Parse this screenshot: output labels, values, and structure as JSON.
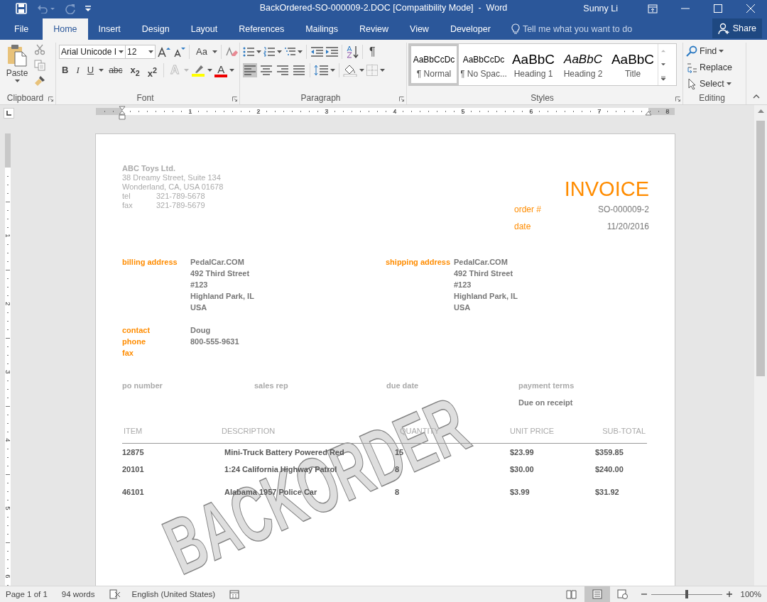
{
  "title_bar": {
    "title": "BackOrdered-SO-000009-2.DOC [Compatibility Mode]  -  Word",
    "user": "Sunny Li"
  },
  "tabs": [
    {
      "label": "File",
      "selected": false
    },
    {
      "label": "Home",
      "selected": true
    },
    {
      "label": "Insert",
      "selected": false
    },
    {
      "label": "Design",
      "selected": false
    },
    {
      "label": "Layout",
      "selected": false
    },
    {
      "label": "References",
      "selected": false
    },
    {
      "label": "Mailings",
      "selected": false
    },
    {
      "label": "Review",
      "selected": false
    },
    {
      "label": "View",
      "selected": false
    },
    {
      "label": "Developer",
      "selected": false
    }
  ],
  "tell_me": {
    "placeholder": "Tell me what you want to do"
  },
  "share": {
    "label": "Share"
  },
  "ribbon": {
    "clipboard": {
      "label": "Clipboard",
      "paste": "Paste"
    },
    "font": {
      "label": "Font",
      "font_name": "Arial Unicode I",
      "font_size": "12",
      "change_case": "Aa",
      "buttons": [
        {
          "kind": "bold",
          "label": "B"
        },
        {
          "kind": "italic",
          "label": "I"
        },
        {
          "kind": "underline",
          "label": "U"
        },
        {
          "kind": "strike",
          "label": "abc"
        },
        {
          "kind": "sub",
          "label": "x$_{2}$"
        },
        {
          "kind": "sup",
          "label": "x$^{2}$"
        }
      ],
      "text_effects": "A",
      "font_color": "A"
    },
    "paragraph": {
      "label": "Paragraph",
      "pilcrow": "¶",
      "alignment": [
        {
          "kind": "left",
          "selected": true
        },
        {
          "kind": "center",
          "selected": false
        },
        {
          "kind": "right",
          "selected": false
        },
        {
          "kind": "justify",
          "selected": false
        }
      ]
    },
    "styles": {
      "label": "Styles",
      "items": [
        {
          "kind": "normal",
          "preview": "AaBbCcDc",
          "name": "¶ Normal",
          "selected": true
        },
        {
          "kind": "normal",
          "preview": "AaBbCcDc",
          "name": "¶ No Spac...",
          "selected": false
        },
        {
          "kind": "heading",
          "preview": "AaBbC",
          "name": "Heading 1",
          "selected": false
        },
        {
          "kind": "heading_italic",
          "preview": "AaBbC",
          "name": "Heading 2",
          "selected": false
        },
        {
          "kind": "title",
          "preview": "AaBbC",
          "name": "Title",
          "selected": false
        }
      ]
    },
    "editing": {
      "label": "Editing",
      "items": [
        {
          "kind": "find",
          "label": "Find"
        },
        {
          "kind": "replace",
          "label": "Replace"
        },
        {
          "kind": "select",
          "label": "Select"
        }
      ]
    }
  },
  "ruler": {
    "labels": [
      "1",
      "2",
      "3",
      "4",
      "5",
      "6",
      "7",
      "8"
    ]
  },
  "vertical_ruler": {
    "labels": [
      "1",
      "2",
      "3",
      "4",
      "5",
      "6"
    ]
  },
  "document": {
    "company": {
      "name": "ABC Toys Ltd.",
      "address": [
        "38 Dreamy Street, Suite 134",
        "Wonderland, CA, USA 01678"
      ],
      "contacts": [
        {
          "label": "tel",
          "value": "321-789-5678"
        },
        {
          "label": "fax",
          "value": "321-789-5679"
        }
      ]
    },
    "title": "INVOICE",
    "fields": [
      {
        "label": "order #",
        "value": "SO-000009-2"
      },
      {
        "label": "date",
        "value": "11/20/2016"
      }
    ],
    "addresses": [
      {
        "label": "billing address",
        "lines": [
          "PedalCar.COM",
          "492 Third Street",
          "#123",
          "Highland Park, IL",
          "USA"
        ]
      },
      {
        "label": "shipping address",
        "lines": [
          "PedalCar.COM",
          "492 Third Street",
          "#123",
          "Highland Park, IL",
          "USA"
        ]
      }
    ],
    "contact": [
      {
        "label": "contact",
        "value": "Doug"
      },
      {
        "label": "phone",
        "value": "800-555-9631"
      },
      {
        "label": "fax"
      }
    ],
    "terms": [
      {
        "label": "po number"
      },
      {
        "label": "sales rep"
      },
      {
        "label": "due date"
      },
      {
        "label": "payment terms",
        "value": "Due on receipt"
      }
    ],
    "table": {
      "columns": [
        "ITEM",
        "DESCRIPTION",
        "QUANTITY",
        "UNIT PRICE",
        "SUB-TOTAL"
      ],
      "rows": [
        [
          "12875",
          "Mini-Truck Battery Powered Red",
          "15",
          "$23.99",
          "$359.85"
        ],
        [
          "20101",
          "1:24 California Highway Patrol",
          "8",
          "$30.00",
          "$240.00"
        ],
        [
          "46101",
          "Alabama 1957 Police Car",
          "8",
          "$3.99",
          "$31.92"
        ]
      ]
    },
    "watermark": "BACKORDER"
  },
  "status_bar": {
    "page": "Page 1 of 1",
    "words": "94 words",
    "language": "English (United States)",
    "views": [
      {
        "kind": "read",
        "selected": false
      },
      {
        "kind": "print",
        "selected": true
      },
      {
        "kind": "web",
        "selected": false
      }
    ],
    "zoom": {
      "level": 0.5,
      "reading": "100%"
    }
  }
}
